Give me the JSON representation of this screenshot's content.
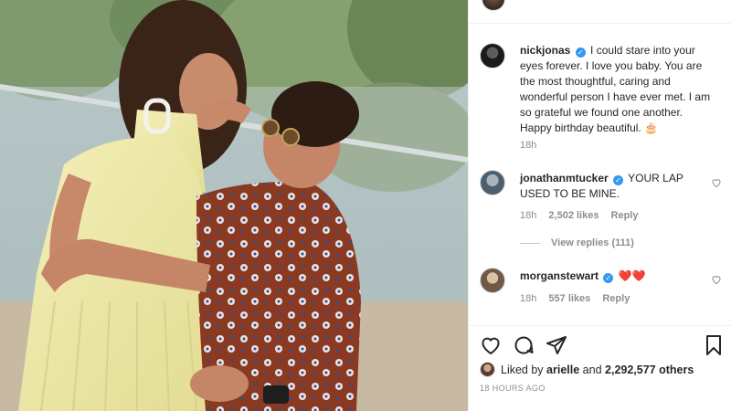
{
  "post": {
    "caption": {
      "username": "nickjonas",
      "text": "I could stare into your eyes forever. I love you baby. You are the most thoughtful, caring and wonderful person I have ever met. I am so grateful we found one another. Happy birthday beautiful. 🎂",
      "time": "18h"
    },
    "comments": [
      {
        "username": "jonathanmtucker",
        "text": "YOUR LAP USED TO BE MINE.",
        "time": "18h",
        "likes": "2,502 likes",
        "reply": "Reply",
        "view_replies": "View replies (111)"
      },
      {
        "username": "morganstewart",
        "text": "❤️❤️",
        "time": "18h",
        "likes": "557 likes",
        "reply": "Reply"
      }
    ],
    "liked_by": {
      "prefix": "Liked by",
      "user": "arielle",
      "conjunction": "and",
      "others": "2,292,577 others"
    },
    "timestamp": "18 HOURS AGO"
  },
  "icons": {
    "like": "heart-outline-icon",
    "comment": "comment-bubble-icon",
    "share": "paper-plane-icon",
    "save": "bookmark-icon",
    "verified": "verified-badge-icon",
    "comment_like": "small-heart-icon"
  },
  "colors": {
    "verified": "#3897f0",
    "muted": "#8e8e8e",
    "text": "#262626",
    "heart_red": "#ed4956"
  }
}
